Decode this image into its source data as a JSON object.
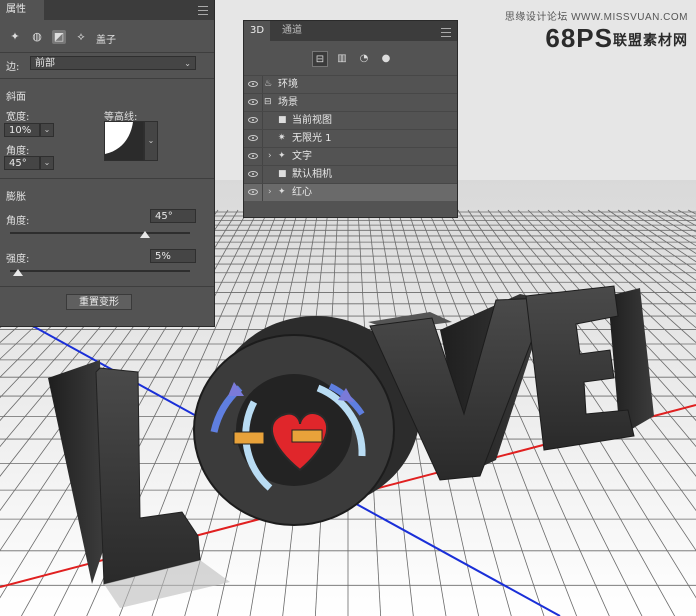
{
  "watermark": {
    "top_text": "思缘设计论坛 WWW.MISSVUAN.COM",
    "logo_text": "68PS",
    "logo_sub": "联盟素材网"
  },
  "scene": {
    "letters": [
      "L",
      "O",
      "V",
      "E"
    ],
    "colors": {
      "grid_line": "#6a6a6a",
      "x_axis": "#e02020",
      "z_axis": "#1a2fd8",
      "letter": "#3a3a3a",
      "ring_light": "#b9dcf3",
      "ring_dark": "#5f7fe0",
      "heart": "#e0262b"
    }
  },
  "properties_panel": {
    "tab_label": "属性",
    "icons": [
      "mesh-icon",
      "deform-icon",
      "cap-icon",
      "coordinates-icon"
    ],
    "cap_label": "盖子",
    "edge_label": "边:",
    "edge_value": "前部",
    "bevel_title": "斜面",
    "width_label": "宽度:",
    "width_value": "10%",
    "contour_label": "等高线:",
    "angle_label": "角度:",
    "angle_value": "45°",
    "inflate_title": "膨胀",
    "inflate_angle_label": "角度:",
    "inflate_angle_value": "45°",
    "strength_label": "强度:",
    "strength_value": "5%",
    "reset_button": "重置变形"
  },
  "panel_3d": {
    "tabs": [
      "3D",
      "通道"
    ],
    "filters": [
      "whole-scene-icon",
      "meshes-icon",
      "materials-icon",
      "lights-icon"
    ],
    "layers": [
      {
        "label": "环境",
        "icon": "environment-icon",
        "expandable": false,
        "selected": false
      },
      {
        "label": "场景",
        "icon": "scene-icon",
        "expandable": false,
        "selected": false
      },
      {
        "label": "当前视图",
        "icon": "camera-icon",
        "expandable": false,
        "selected": false
      },
      {
        "label": "无限光 1",
        "icon": "sun-icon",
        "expandable": false,
        "selected": false
      },
      {
        "label": "文字",
        "icon": "mesh-icon",
        "expandable": true,
        "selected": false
      },
      {
        "label": "默认相机",
        "icon": "camera-icon",
        "expandable": false,
        "selected": false
      },
      {
        "label": "红心",
        "icon": "mesh-icon",
        "expandable": true,
        "selected": true
      }
    ]
  }
}
